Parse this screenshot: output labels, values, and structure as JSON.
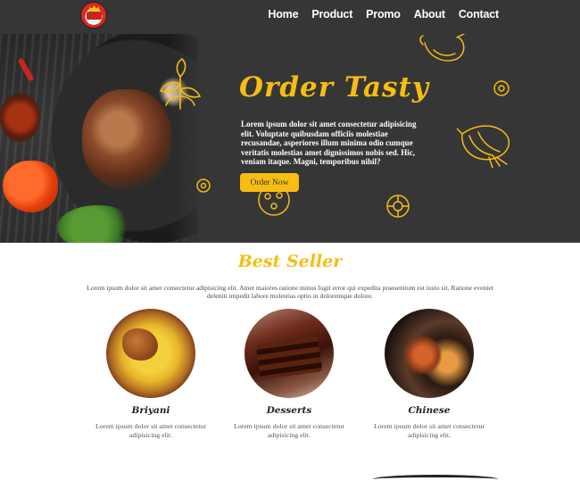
{
  "nav": {
    "logo_icon": "restaurant-logo",
    "items": [
      "Home",
      "Product",
      "Promo",
      "About",
      "Contact"
    ]
  },
  "hero": {
    "title": "Order Tasty",
    "text": "Lorem ipsum dolor sit amet consectetur adipisicing elit. Voluptate quibusdam officiis molestiae recusandae, asperiores illum minima odio cumque veritatis molestias amet dignissimos nobis sed. Hic, veniam itaque. Magni, temporibus nihil?",
    "button": "Order Now",
    "accent_color": "#f7bd13",
    "background_color": "#363636"
  },
  "best_seller": {
    "title": "Best Seller",
    "description": "Lorem ipsum dolor sit amet consectetur adipisicing elit. Amet maiores ratione minus fugit error qui expedita praesentium est iusto sit. Ratione eveniet deleniti impedit labore molestias optio in doloremque dolore.",
    "items": [
      {
        "name": "Briyani",
        "desc": "Lorem ipsum dolor sit amet consectetur adipisicing elit."
      },
      {
        "name": "Desserts",
        "desc": "Lorem ipsum dolor sit amet consectetur adipisicing elit."
      },
      {
        "name": "Chinese",
        "desc": "Lorem ipsum dolor sit amet consectetur adipisicing elit."
      }
    ]
  }
}
